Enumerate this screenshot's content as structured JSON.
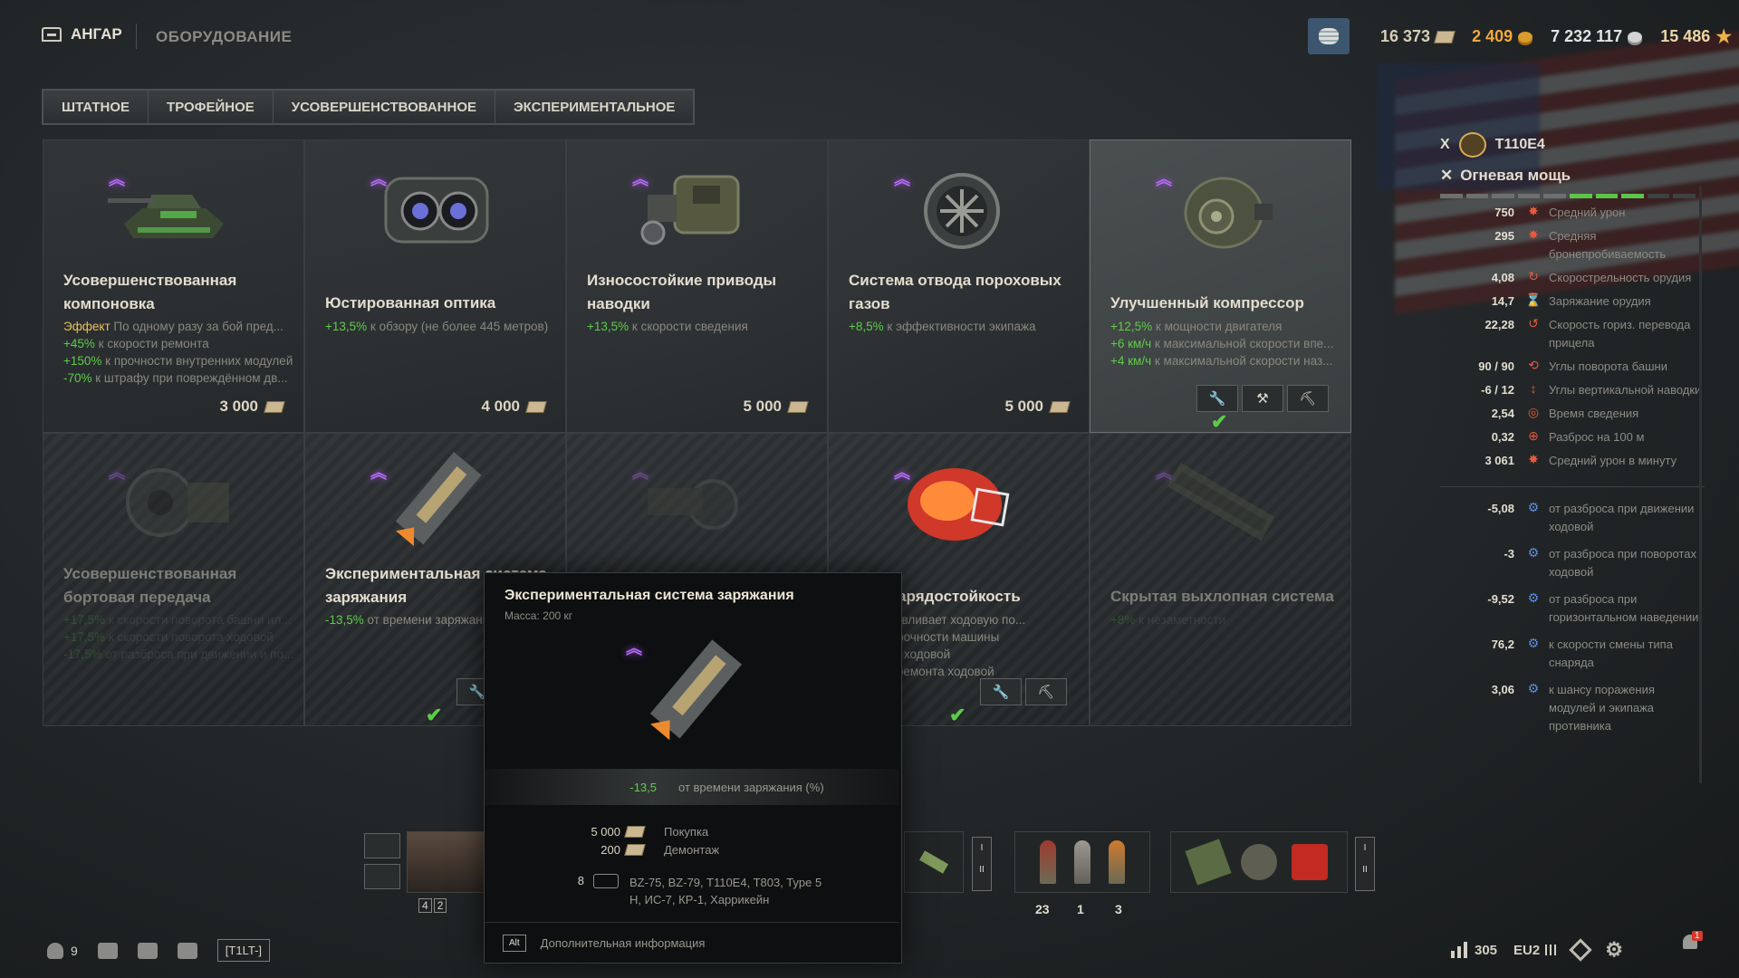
{
  "header": {
    "hangar_label": "АНГАР",
    "section_label": "ОБОРУДОВАНИЕ",
    "currencies": {
      "bonds": "16 373",
      "gold": "2 409",
      "credits": "7 232 117",
      "free_xp": "15 486"
    }
  },
  "tabs": [
    "ШТАТНОЕ",
    "ТРОФЕЙНОЕ",
    "УСОВЕРШЕНСТВОВАННОЕ",
    "ЭКСПЕРИМЕНТАЛЬНОЕ"
  ],
  "cards": [
    {
      "title": "Усовершенствованная компоновка",
      "stats": [
        {
          "effect": "Эффект",
          "text": " По одному разу за бой пред..."
        },
        {
          "value": "+45%",
          "text": " к скорости ремонта"
        },
        {
          "value": "+150%",
          "text": " к прочности внутренних модулей"
        },
        {
          "value": "-70%",
          "text": " к штрафу при повреждённом дв..."
        }
      ],
      "price": "3 000"
    },
    {
      "title": "Юстированная оптика",
      "stats": [
        {
          "value": "+13,5%",
          "text": " к обзору (не более 445 метров)"
        }
      ],
      "price": "4 000"
    },
    {
      "title": "Износостойкие приводы наводки",
      "stats": [
        {
          "value": "+13,5%",
          "text": " к скорости сведения"
        }
      ],
      "price": "5 000"
    },
    {
      "title": "Система отвода пороховых газов",
      "stats": [
        {
          "value": "+8,5%",
          "text": " к эффективности экипажа"
        }
      ],
      "price": "5 000"
    },
    {
      "title": "Улучшенный компрессор",
      "stats": [
        {
          "value": "+12,5%",
          "text": " к мощности двигателя"
        },
        {
          "value": "+6 км/ч",
          "text": " к максимальной скорости впе..."
        },
        {
          "value": "+4 км/ч",
          "text": " к максимальной скорости наз..."
        }
      ]
    },
    {
      "title": "Усовершенствованная бортовая передача",
      "stats": [
        {
          "value": "+17,5%",
          "text": " к скорости поворота башни ил..."
        },
        {
          "value": "+17,5%",
          "text": " к скорости поворота ходовой"
        },
        {
          "value": "-17,5%",
          "text": " от разброса при движении и по..."
        }
      ]
    },
    {
      "title": "Экспериментальная система заряжания",
      "stats": [
        {
          "value": "-13,5%",
          "text": " от времени заряжания"
        }
      ]
    },
    {
      "title": "",
      "stats": []
    },
    {
      "title": "ная снарядостойкость",
      "stats": [
        {
          "text": "Восстанавливает ходовую по..."
        },
        {
          "text": "запасу прочности машины"
        },
        {
          "text": "рочности ходовой"
        },
        {
          "text": "корости ремонта ходовой"
        }
      ]
    },
    {
      "title": "Скрытая выхлопная система",
      "stats": [
        {
          "value": "+8%",
          "text": " к незаметности"
        }
      ]
    }
  ],
  "tank": {
    "tier": "X",
    "name": "T110E4",
    "section": "Огневая мощь",
    "stats": [
      {
        "value": "750",
        "label": "Средний урон"
      },
      {
        "value": "295",
        "label": "Средняя бронепробиваемость"
      },
      {
        "value": "4,08",
        "label": "Скорострельность орудия"
      },
      {
        "value": "14,7",
        "label": "Заряжание орудия"
      },
      {
        "value": "22,28",
        "label": "Скорость гориз. перевода прицела"
      },
      {
        "value": "90 / 90",
        "label": "Углы поворота башни"
      },
      {
        "value": "-6 / 12",
        "label": "Углы вертикальной наводки"
      },
      {
        "value": "2,54",
        "label": "Время сведения"
      },
      {
        "value": "0,32",
        "label": "Разброс на 100 м"
      },
      {
        "value": "3 061",
        "label": "Средний урон в минуту"
      }
    ],
    "bonuses": [
      {
        "value": "-5,08",
        "label": "от разброса при движении ходовой"
      },
      {
        "value": "-3",
        "label": "от разброса при поворотах ходовой"
      },
      {
        "value": "-9,52",
        "label": "от разброса при горизонтальном наведении"
      },
      {
        "value": "76,2",
        "label": "к скорости смены типа снаряда"
      },
      {
        "value": "3,06",
        "label": "к шансу поражения модулей и экипажа противника"
      }
    ]
  },
  "bottom": {
    "crew_counts": [
      "4",
      "2"
    ],
    "shells": [
      "23",
      "1",
      "3"
    ],
    "online": "9",
    "platoon": "[T1LT-]",
    "rating": "305",
    "server": "EU2",
    "notifications": "1"
  },
  "tooltip": {
    "title": "Экспериментальная система заряжания",
    "mass": "Масса: 200 кг",
    "effect_value": "-13,5",
    "effect_label": "от времени заряжания (%)",
    "buy_value": "5 000",
    "buy_label": "Покупка",
    "demount_value": "200",
    "demount_label": "Демонтаж",
    "tanks_count": "8",
    "tanks_list": "BZ-75, BZ-79, T110E4, T803, Type 5 Н, ИС-7, КР-1, Харрикейн",
    "alt_key": "Alt",
    "alt_label": "Дополнительная информация"
  }
}
